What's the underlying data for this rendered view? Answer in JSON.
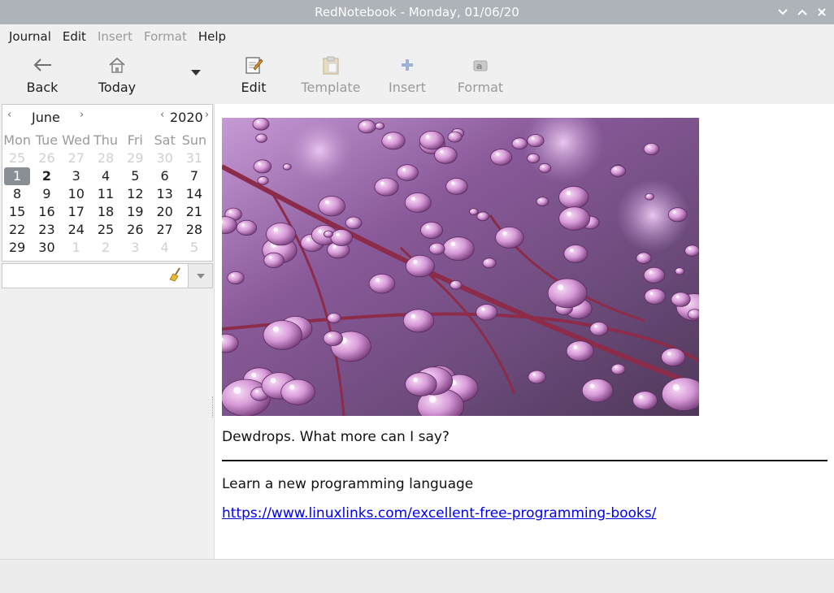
{
  "window": {
    "title": "RedNotebook - Monday, 01/06/20"
  },
  "menu": [
    {
      "label": "Journal",
      "enabled": true
    },
    {
      "label": "Edit",
      "enabled": true
    },
    {
      "label": "Insert",
      "enabled": false
    },
    {
      "label": "Format",
      "enabled": false
    },
    {
      "label": "Help",
      "enabled": true
    }
  ],
  "toolbar": {
    "back": "Back",
    "today": "Today",
    "edit": "Edit",
    "template": "Template",
    "insert": "Insert",
    "format": "Format"
  },
  "calendar": {
    "month": "June",
    "year": "2020",
    "weekdays": [
      "Mon",
      "Tue",
      "Wed",
      "Thu",
      "Fri",
      "Sat",
      "Sun"
    ],
    "weeks": [
      [
        "25",
        "26",
        "27",
        "28",
        "29",
        "30",
        "31"
      ],
      [
        "1",
        "2",
        "3",
        "4",
        "5",
        "6",
        "7"
      ],
      [
        "8",
        "9",
        "10",
        "11",
        "12",
        "13",
        "14"
      ],
      [
        "15",
        "16",
        "17",
        "18",
        "19",
        "20",
        "21"
      ],
      [
        "22",
        "23",
        "24",
        "25",
        "26",
        "27",
        "28"
      ],
      [
        "29",
        "30",
        "1",
        "2",
        "3",
        "4",
        "5"
      ]
    ],
    "selected_day": "1",
    "bold_day": "2"
  },
  "search": {
    "value": ""
  },
  "entry": {
    "caption": "Dewdrops. What more can I say?",
    "heading": "Learn a new programming language",
    "link": "https://www.linuxlinks.com/excellent-free-programming-books/"
  },
  "colors": {
    "titlebar": "#aeb3b9",
    "selected_day": "#8a8f95",
    "link": "#0000ee"
  }
}
